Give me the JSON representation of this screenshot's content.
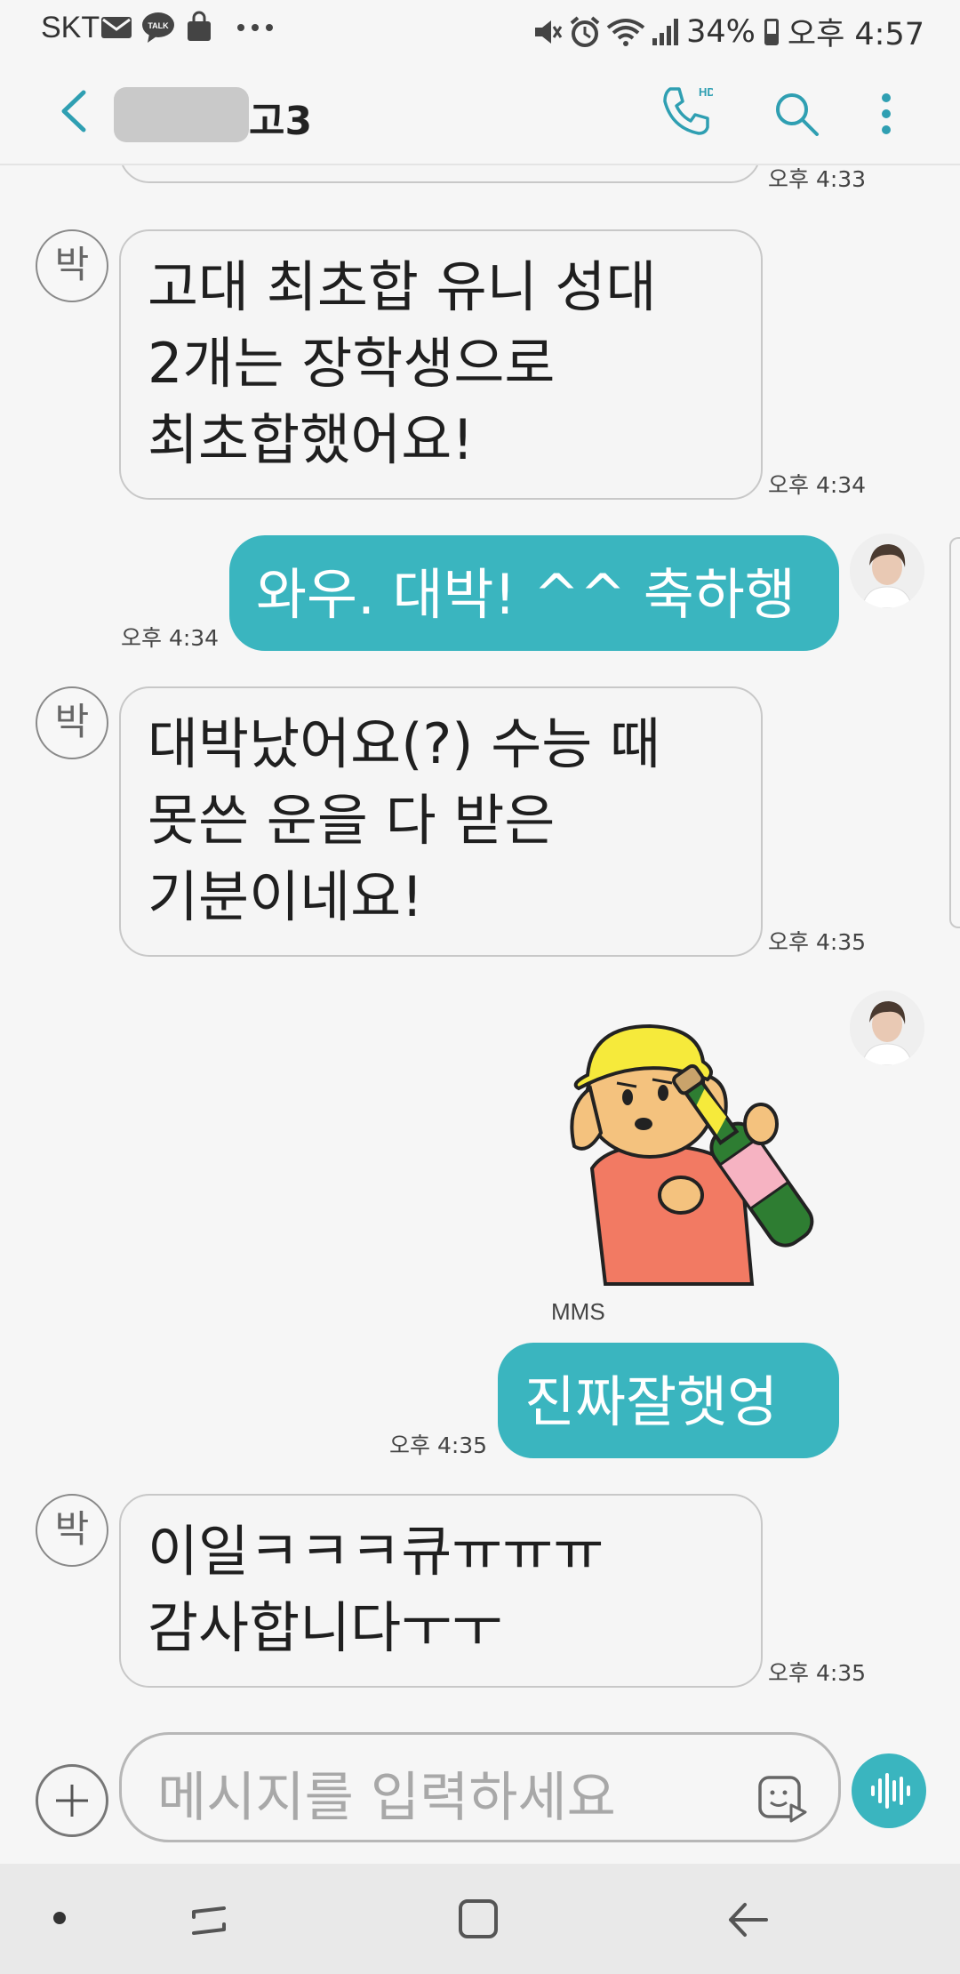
{
  "status_bar": {
    "carrier": "SKT",
    "battery": "34%",
    "time": "오후 4:57",
    "icons": [
      "mail-icon",
      "kakaotalk-icon",
      "shopping-bag-icon",
      "more-dots-icon",
      "mute-icon",
      "alarm-icon",
      "wifi-icon",
      "signal-icon",
      "battery-icon"
    ]
  },
  "header": {
    "contact_name": "고3",
    "icons": [
      "back-icon",
      "hd-call-icon",
      "search-icon",
      "more-vertical-icon"
    ],
    "call_badge": "HD"
  },
  "messages": [
    {
      "id": "m0",
      "direction": "in",
      "text": "",
      "time": "오후 4:33"
    },
    {
      "id": "m1",
      "direction": "in",
      "avatar": "박",
      "text": "고대 최초합 유니 성대\n2개는 장학생으로\n최초합했어요!",
      "time": "오후 4:34"
    },
    {
      "id": "m2",
      "direction": "out",
      "text": "와우. 대박! ^^  축하행",
      "time": "오후 4:34"
    },
    {
      "id": "m3",
      "direction": "in",
      "avatar": "박",
      "text": "대박났어요(?) 수능 때\n못쓴 운을 다 받은\n기분이네요!",
      "time": "오후 4:35"
    },
    {
      "id": "m4",
      "direction": "out",
      "type": "sticker",
      "label": "MMS",
      "sticker": "dog-with-champagne-sticker"
    },
    {
      "id": "m5",
      "direction": "out",
      "text": "진짜잘햇엉",
      "time": "오후 4:35"
    },
    {
      "id": "m6",
      "direction": "in",
      "avatar": "박",
      "text": "이일ㅋㅋㅋ큐ㅠㅠㅠ\n감사합니다ㅜㅜ",
      "time": "오후 4:35"
    }
  ],
  "input_bar": {
    "placeholder": "메시지를 입력하세요"
  },
  "colors": {
    "accent": "#3ab5bf",
    "background": "#f6f6f6",
    "incoming_bubble": "#f5f5f5"
  }
}
